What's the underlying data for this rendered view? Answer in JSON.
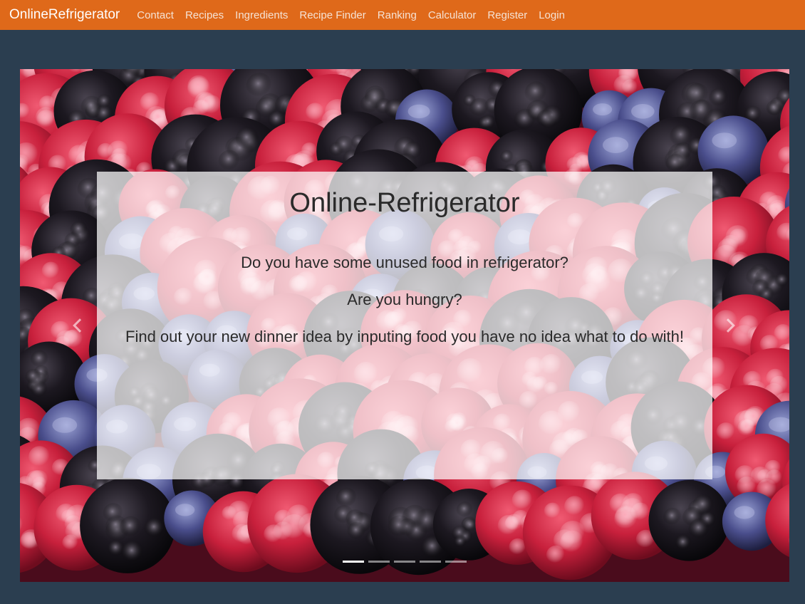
{
  "navbar": {
    "brand": "OnlineRefrigerator",
    "links": [
      "Contact",
      "Recipes",
      "Ingredients",
      "Recipe Finder",
      "Ranking",
      "Calculator",
      "Register",
      "Login"
    ],
    "background_color": "#df691a"
  },
  "page": {
    "background_color": "#2b3e50"
  },
  "carousel": {
    "image": "berries-photo",
    "caption": {
      "title": "Online-Refrigerator",
      "lines": [
        "Do you have some unused food in refrigerator?",
        "Are you hungry?",
        "Find out your new dinner idea by inputing food you have no idea what to do with!"
      ]
    },
    "prev_icon": "chevron-left-icon",
    "next_icon": "chevron-right-icon",
    "slide_count": 5,
    "active_slide": 1
  }
}
